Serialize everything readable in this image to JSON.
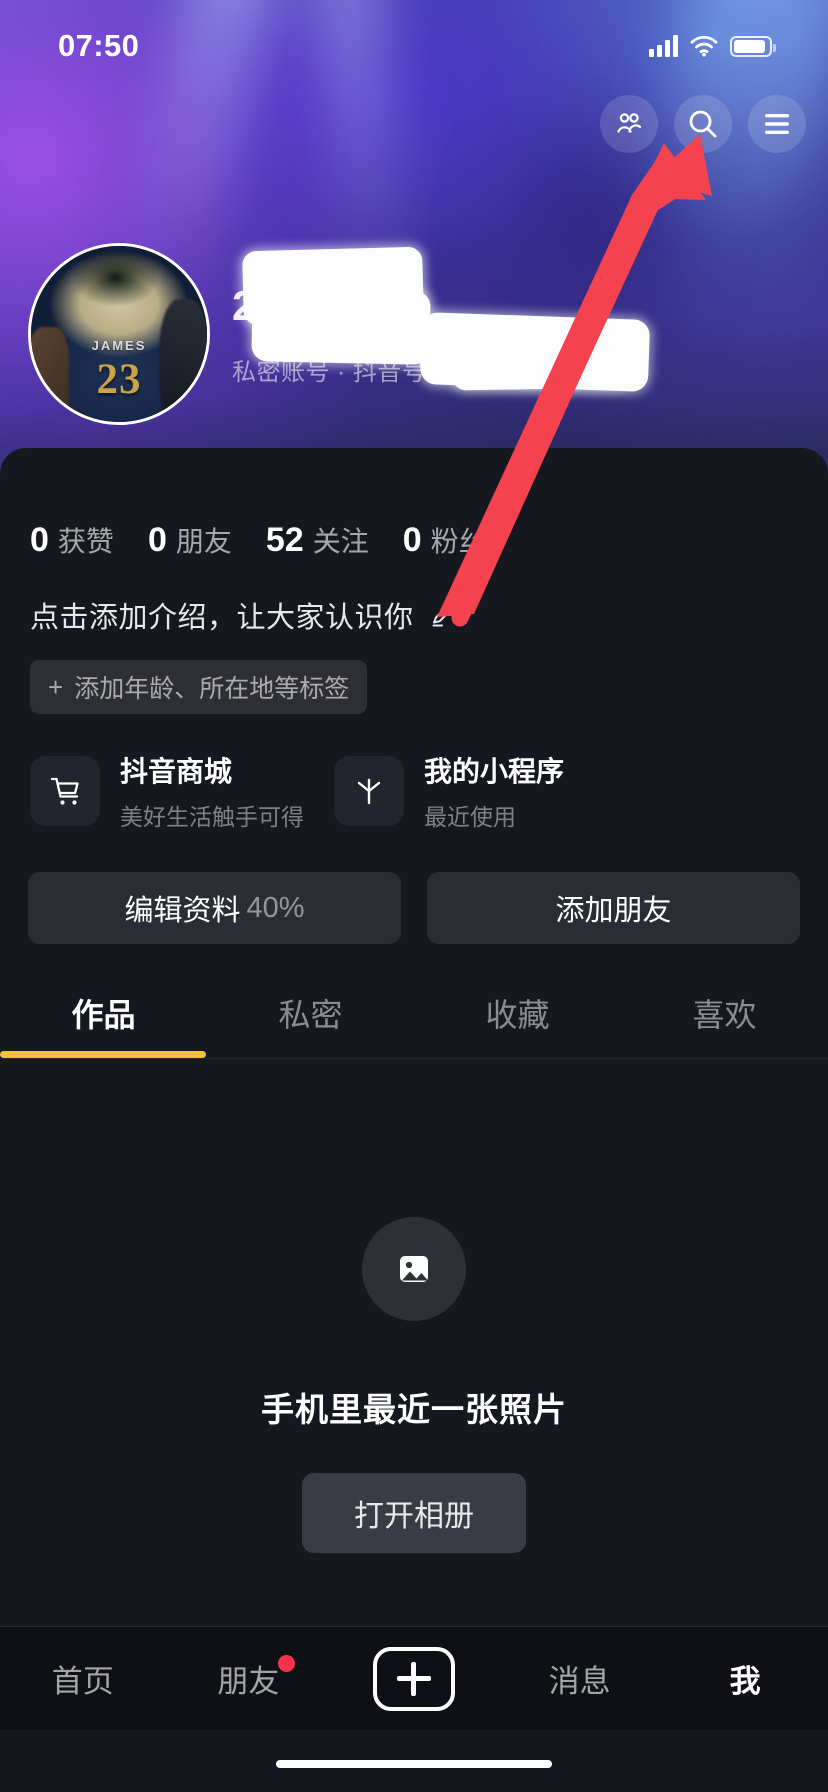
{
  "status_bar": {
    "time": "07:50",
    "signal_icon": "cellular-signal-icon",
    "wifi_icon": "wifi-icon",
    "battery_icon": "battery-icon"
  },
  "header": {
    "friends_icon": "two-people-icon",
    "search_icon": "search-icon",
    "menu_icon": "hamburger-menu-icon"
  },
  "profile": {
    "avatar_icon": "avatar",
    "avatar_jersey_name": "JAMES",
    "avatar_jersey_number": "23",
    "display_name": "2",
    "dropdown_icon": "chevron-down-icon",
    "sub_line": "私密账号 · 抖音号:",
    "redacted": true
  },
  "stats": [
    {
      "value": "0",
      "label": "获赞"
    },
    {
      "value": "0",
      "label": "朋友"
    },
    {
      "value": "52",
      "label": "关注"
    },
    {
      "value": "0",
      "label": "粉丝"
    }
  ],
  "bio": {
    "placeholder": "点击添加介绍，让大家认识你",
    "edit_icon": "pencil-edit-icon",
    "tag_plus": "+",
    "tag_label": "添加年龄、所在地等标签"
  },
  "services": [
    {
      "icon": "shopping-cart-icon",
      "title": "抖音商城",
      "subtitle": "美好生活触手可得"
    },
    {
      "icon": "mini-program-asterisk-icon",
      "title": "我的小程序",
      "subtitle": "最近使用"
    }
  ],
  "actions": {
    "edit_profile_label": "编辑资料",
    "edit_profile_percent": "40%",
    "add_friend_label": "添加朋友"
  },
  "tabs": {
    "items": [
      {
        "label": "作品",
        "active": true
      },
      {
        "label": "私密",
        "active": false
      },
      {
        "label": "收藏",
        "active": false
      },
      {
        "label": "喜欢",
        "active": false
      }
    ],
    "active_underline_color": "#F2C13C"
  },
  "empty_state": {
    "icon": "photo-image-icon",
    "title": "手机里最近一张照片",
    "button_label": "打开相册"
  },
  "bottom_nav": {
    "items": [
      {
        "label": "首页",
        "active": false,
        "badge": false
      },
      {
        "label": "朋友",
        "active": false,
        "badge": true
      },
      {
        "label": "",
        "active": false,
        "badge": false,
        "icon": "plus-create-icon"
      },
      {
        "label": "消息",
        "active": false,
        "badge": false
      },
      {
        "label": "我",
        "active": true,
        "badge": false
      }
    ],
    "badge_color": "#F6314B"
  },
  "annotation": {
    "arrow_icon": "red-arrow-annotation",
    "arrow_color": "#F4434E",
    "points_to": "hamburger-menu-icon"
  }
}
